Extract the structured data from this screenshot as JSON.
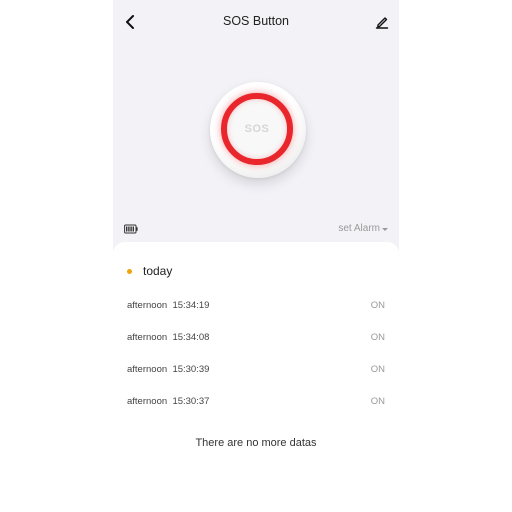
{
  "header": {
    "title": "SOS Button"
  },
  "device": {
    "label": "SOS",
    "ring_color": "#e8262b"
  },
  "toolbar": {
    "set_alarm_label": "set Alarm"
  },
  "history": {
    "day_label": "today",
    "records": [
      {
        "period": "afternoon",
        "time": "15:34:19",
        "state": "ON"
      },
      {
        "period": "afternoon",
        "time": "15:34:08",
        "state": "ON"
      },
      {
        "period": "afternoon",
        "time": "15:30:39",
        "state": "ON"
      },
      {
        "period": "afternoon",
        "time": "15:30:37",
        "state": "ON"
      }
    ],
    "end_text": "There are no more datas"
  }
}
